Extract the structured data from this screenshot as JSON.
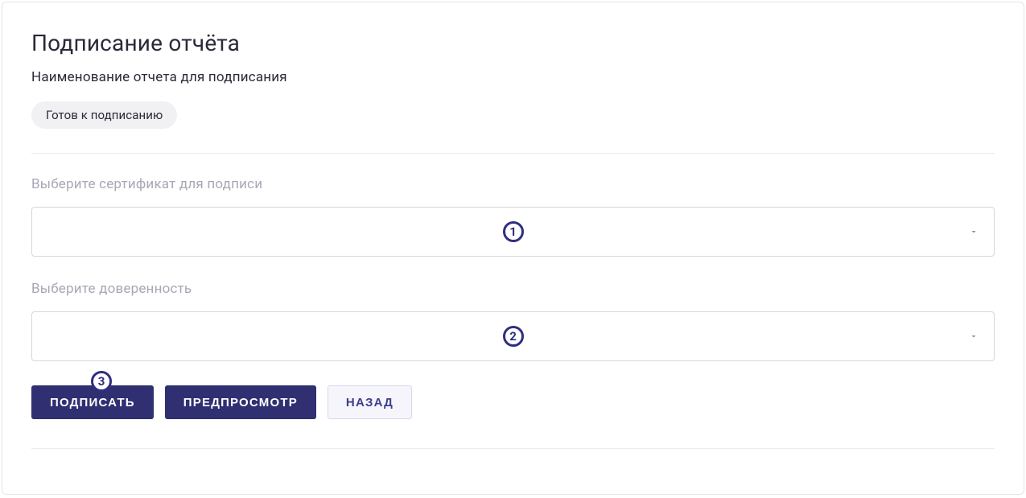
{
  "header": {
    "title": "Подписание отчёта",
    "report_name": "Наименование отчета для подписания",
    "status_badge": "Готов к подписанию"
  },
  "fields": {
    "certificate": {
      "label": "Выберите сертификат для подписи",
      "value": "",
      "callout": "1"
    },
    "authority": {
      "label": "Выберите доверенность",
      "value": "",
      "callout": "2"
    }
  },
  "buttons": {
    "sign": {
      "label": "ПОДПИСАТЬ",
      "callout": "3"
    },
    "preview": {
      "label": "ПРЕДПРОСМОТР"
    },
    "back": {
      "label": "НАЗАД"
    }
  }
}
